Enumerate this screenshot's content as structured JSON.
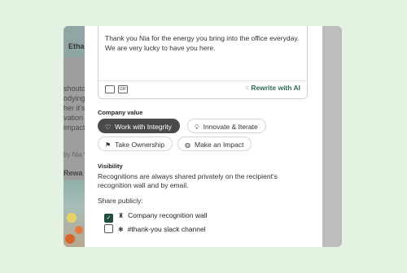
{
  "background_card": {
    "name": "Ethan",
    "text_lines": [
      "shoutou",
      "odying",
      "her it's",
      "vation of",
      "impact"
    ],
    "meta": "by Nia W",
    "reward": "Rewa"
  },
  "message": {
    "text": "Thank you Nia for the energy you bring into the office everyday. We are very lucky to have you here.",
    "gif_label": "GIF",
    "rewrite_label": "Rewrite with AI"
  },
  "company_value": {
    "label": "Company value",
    "chips": [
      {
        "label": "Work with Integrity",
        "icon": "heart-icon",
        "selected": true
      },
      {
        "label": "Innovate & Iterate",
        "icon": "lightbulb-icon",
        "selected": false
      },
      {
        "label": "Take Ownership",
        "icon": "flag-icon",
        "selected": false
      },
      {
        "label": "Make an Impact",
        "icon": "globe-icon",
        "selected": false
      }
    ]
  },
  "visibility": {
    "label": "Visibility",
    "description": "Recognitions are always shared privately on the recipient's recognition wall and by email.",
    "share_label": "Share publicly:",
    "options": [
      {
        "label": "Company recognition wall",
        "icon": "trophy-icon",
        "checked": true
      },
      {
        "label": "#thank-you slack channel",
        "icon": "slack-icon",
        "checked": false
      }
    ]
  },
  "colors": {
    "page_bg": "#e3f2e1",
    "accent": "#2e6b57",
    "selected_chip": "#4a4a4a",
    "checkbox_checked": "#1f4d3d"
  }
}
